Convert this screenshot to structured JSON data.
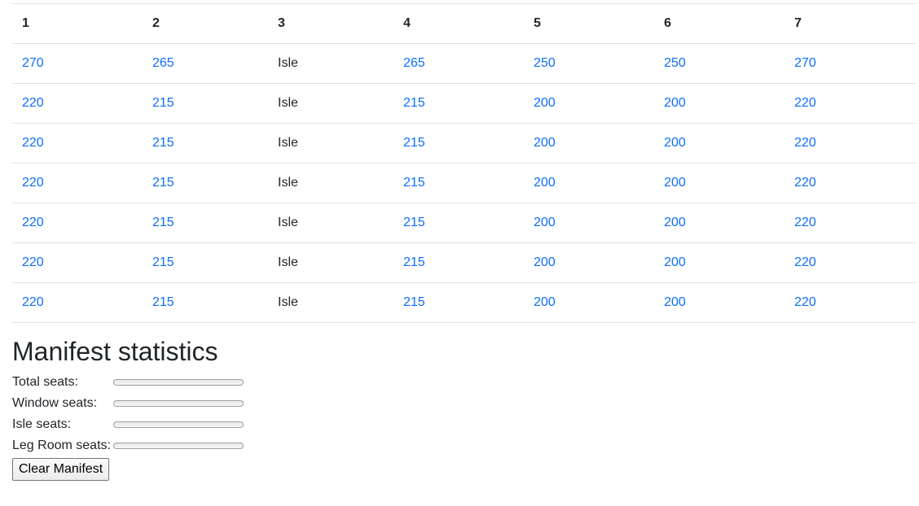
{
  "table": {
    "headers": [
      "1",
      "2",
      "3",
      "4",
      "5",
      "6",
      "7"
    ],
    "rows": [
      [
        "270",
        "265",
        "Isle",
        "265",
        "250",
        "250",
        "270"
      ],
      [
        "220",
        "215",
        "Isle",
        "215",
        "200",
        "200",
        "220"
      ],
      [
        "220",
        "215",
        "Isle",
        "215",
        "200",
        "200",
        "220"
      ],
      [
        "220",
        "215",
        "Isle",
        "215",
        "200",
        "200",
        "220"
      ],
      [
        "220",
        "215",
        "Isle",
        "215",
        "200",
        "200",
        "220"
      ],
      [
        "220",
        "215",
        "Isle",
        "215",
        "200",
        "200",
        "220"
      ],
      [
        "220",
        "215",
        "Isle",
        "215",
        "200",
        "200",
        "220"
      ]
    ]
  },
  "stats": {
    "title": "Manifest statistics",
    "items": [
      {
        "label": "Total seats:",
        "value": 0
      },
      {
        "label": "Window seats:",
        "value": 0
      },
      {
        "label": "Isle seats:",
        "value": 0
      },
      {
        "label": "Leg Room seats:",
        "value": 0
      }
    ]
  },
  "clear_button": {
    "label": "Clear Manifest"
  },
  "colors": {
    "link": "#0d6efd",
    "text": "#212529",
    "border": "#dee2e6"
  }
}
